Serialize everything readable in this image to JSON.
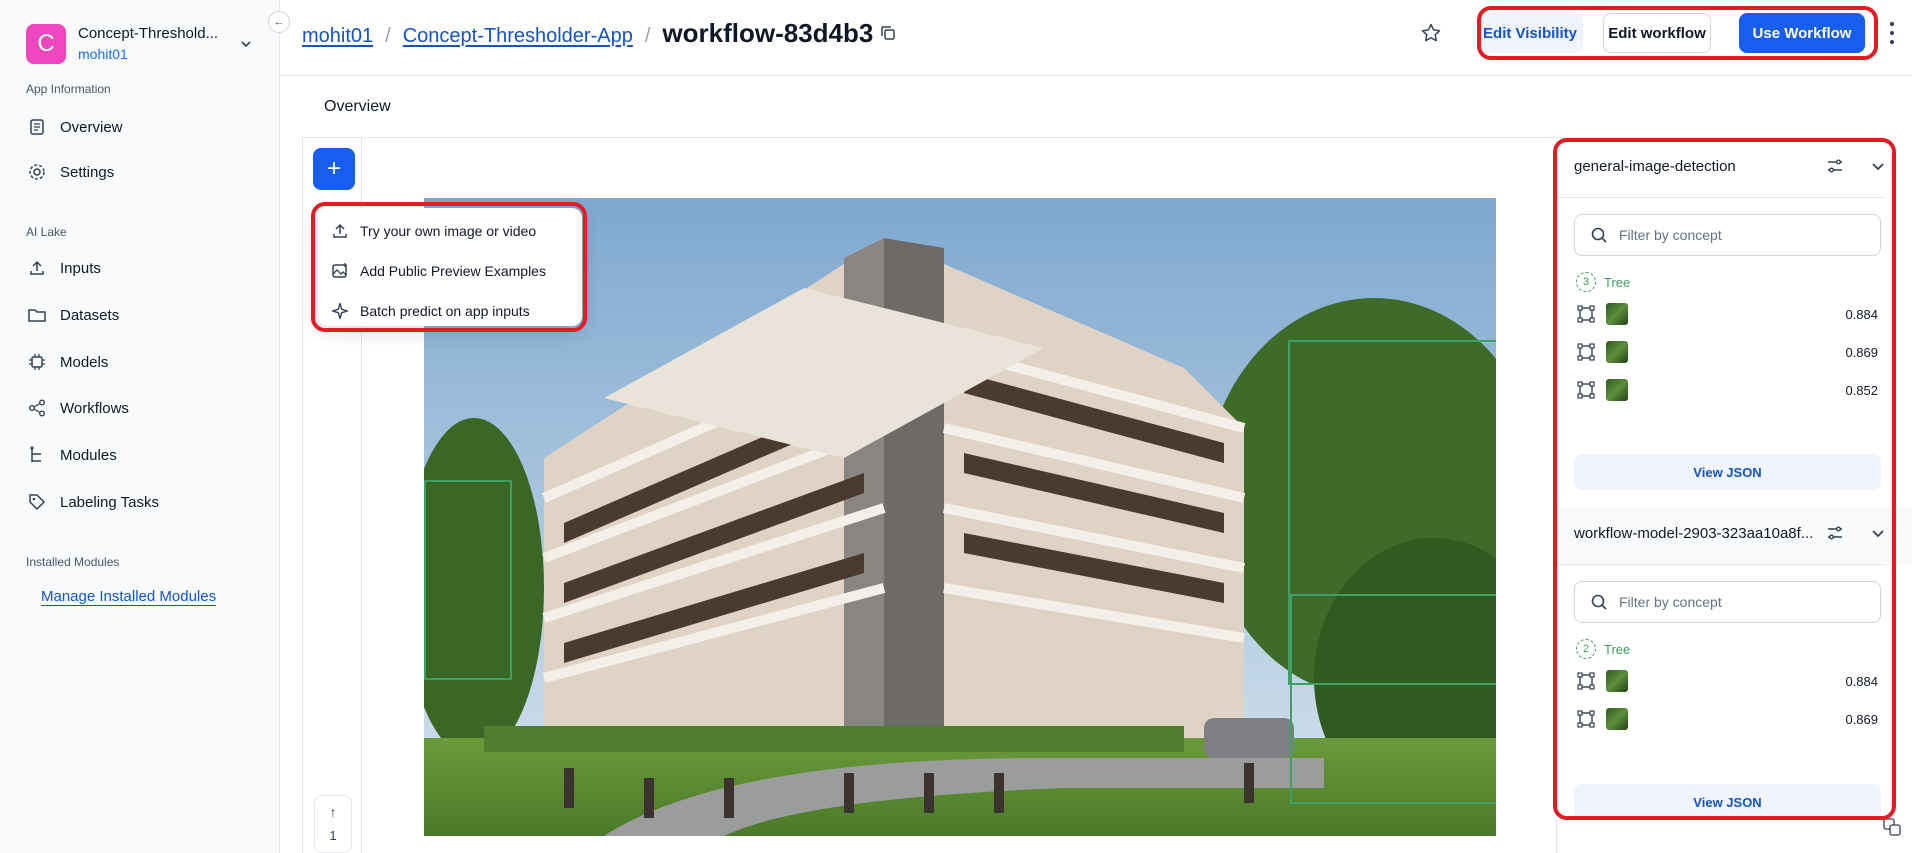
{
  "app": {
    "name": "Concept-Threshold...",
    "avatar_letter": "C",
    "owner": "mohit01",
    "avatar_color": "#ee46bc"
  },
  "sidebar": {
    "section_app_info": "App Information",
    "app_items": [
      {
        "label": "Overview",
        "icon": "document-icon"
      },
      {
        "label": "Settings",
        "icon": "gear-icon"
      }
    ],
    "section_ai_lake": "AI Lake",
    "lake_items": [
      {
        "label": "Inputs",
        "icon": "upload-icon"
      },
      {
        "label": "Datasets",
        "icon": "folder-icon"
      },
      {
        "label": "Models",
        "icon": "chip-icon"
      },
      {
        "label": "Workflows",
        "icon": "share-icon"
      },
      {
        "label": "Modules",
        "icon": "hierarchy-icon"
      },
      {
        "label": "Labeling Tasks",
        "icon": "tag-icon"
      }
    ],
    "section_installed": "Installed Modules",
    "manage_link": "Manage Installed Modules"
  },
  "header": {
    "crumb_owner": "mohit01",
    "crumb_app": "Concept-Thresholder-App",
    "crumb_sep": "/",
    "title": "workflow-83d4b3",
    "edit_visibility": "Edit Visibility",
    "edit_workflow": "Edit workflow",
    "use_workflow": "Use Workflow",
    "accent": "#155eef"
  },
  "tabs": {
    "overview": "Overview"
  },
  "canvas": {
    "plus": "+",
    "page_number": "1",
    "page_up": "↑",
    "menu": [
      {
        "label": "Try your own image or video",
        "icon": "upload-icon"
      },
      {
        "label": "Add Public Preview Examples",
        "icon": "image-add-icon"
      },
      {
        "label": "Batch predict on app inputs",
        "icon": "sparkle-icon"
      }
    ]
  },
  "panel": {
    "models": [
      {
        "title": "general-image-detection",
        "filter_placeholder": "Filter by concept",
        "concept": {
          "count": "3",
          "name": "Tree"
        },
        "detections": [
          "0.884",
          "0.869",
          "0.852"
        ],
        "view_json": "View JSON"
      },
      {
        "title": "workflow-model-2903-323aa10a8f...",
        "filter_placeholder": "Filter by concept",
        "concept": {
          "count": "2",
          "name": "Tree"
        },
        "detections": [
          "0.884",
          "0.869"
        ],
        "view_json": "View JSON"
      }
    ]
  }
}
